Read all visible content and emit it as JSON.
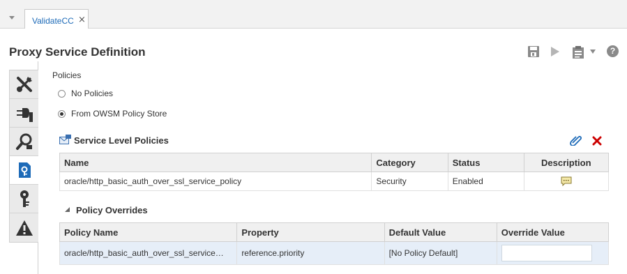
{
  "tabs": [
    {
      "label": "ValidateCC",
      "close": "×"
    }
  ],
  "page_title": "Proxy Service Definition",
  "toolbar": {
    "icons": [
      "save-icon",
      "run-icon",
      "clipboard-icon",
      "dropdown-icon",
      "help-icon"
    ],
    "help_glyph": "?"
  },
  "sidebar_tabs": [
    "tools-icon",
    "plug-icon",
    "search-icon",
    "policy-icon",
    "gears-icon",
    "warning-icon"
  ],
  "policies": {
    "label": "Policies",
    "options": [
      {
        "label": "No Policies",
        "checked": false
      },
      {
        "label": "From OWSM Policy Store",
        "checked": true
      }
    ]
  },
  "service_level_policies": {
    "title": "Service Level Policies",
    "columns": [
      "Name",
      "Category",
      "Status",
      "Description"
    ],
    "rows": [
      {
        "name": "oracle/http_basic_auth_over_ssl_service_policy",
        "category": "Security",
        "status": "Enabled"
      }
    ]
  },
  "policy_overrides": {
    "title": "Policy Overrides",
    "columns": [
      "Policy Name",
      "Property",
      "Default Value",
      "Override Value"
    ],
    "rows": [
      {
        "policy_name": "oracle/http_basic_auth_over_ssl_service…",
        "property": "reference.priority",
        "default_value": "[No Policy Default]",
        "override_value": ""
      }
    ]
  },
  "colors": {
    "accent": "#1e6bb8",
    "delete": "#cc0000",
    "header_bg": "#f0f0f0"
  }
}
